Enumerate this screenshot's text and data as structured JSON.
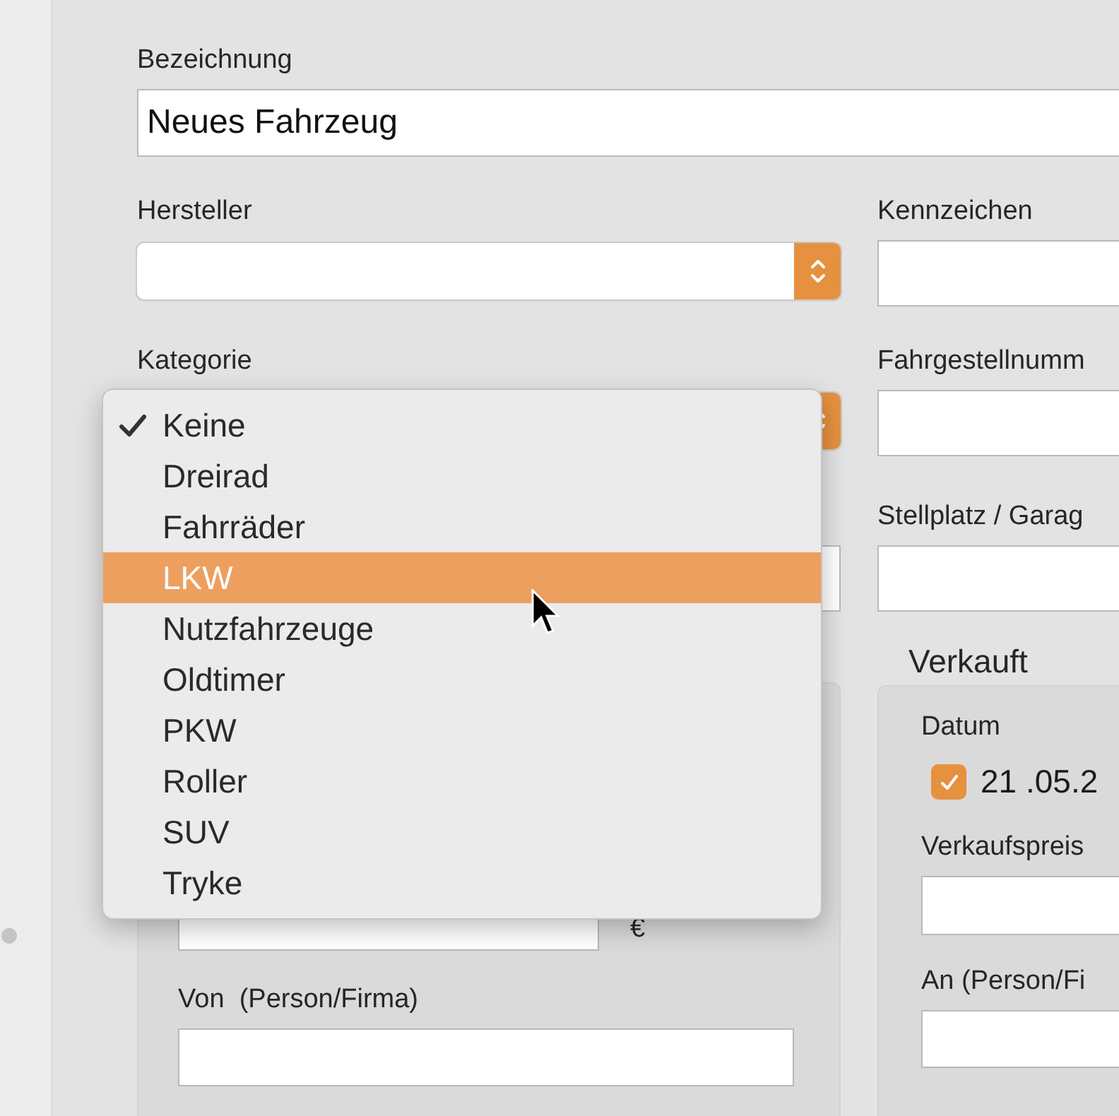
{
  "name_field": {
    "label": "Bezeichnung",
    "value": "Neues Fahrzeug"
  },
  "manufacturer": {
    "label": "Hersteller"
  },
  "license_plate": {
    "label": "Kennzeichen"
  },
  "category": {
    "label": "Kategorie"
  },
  "chassis_number": {
    "label": "Fahrgestellnumm"
  },
  "parking": {
    "label": "Stellplatz / Garag"
  },
  "purchase_group": {
    "currency": "€",
    "from_label": "Von  (Person/Firma)"
  },
  "sold_group": {
    "title": "Verkauft",
    "date_label": "Datum",
    "date_checked": true,
    "date_value": "21 .05.2",
    "price_label": "Verkaufspreis",
    "to_label": "An (Person/Fi"
  },
  "category_menu": {
    "items": [
      {
        "label": "Keine",
        "checked": true,
        "selected": false
      },
      {
        "label": "Dreirad",
        "checked": false,
        "selected": false
      },
      {
        "label": "Fahrräder",
        "checked": false,
        "selected": false
      },
      {
        "label": "LKW",
        "checked": false,
        "selected": true
      },
      {
        "label": "Nutzfahrzeuge",
        "checked": false,
        "selected": false
      },
      {
        "label": "Oldtimer",
        "checked": false,
        "selected": false
      },
      {
        "label": "PKW",
        "checked": false,
        "selected": false
      },
      {
        "label": "Roller",
        "checked": false,
        "selected": false
      },
      {
        "label": "SUV",
        "checked": false,
        "selected": false
      },
      {
        "label": "Tryke",
        "checked": false,
        "selected": false
      }
    ]
  }
}
